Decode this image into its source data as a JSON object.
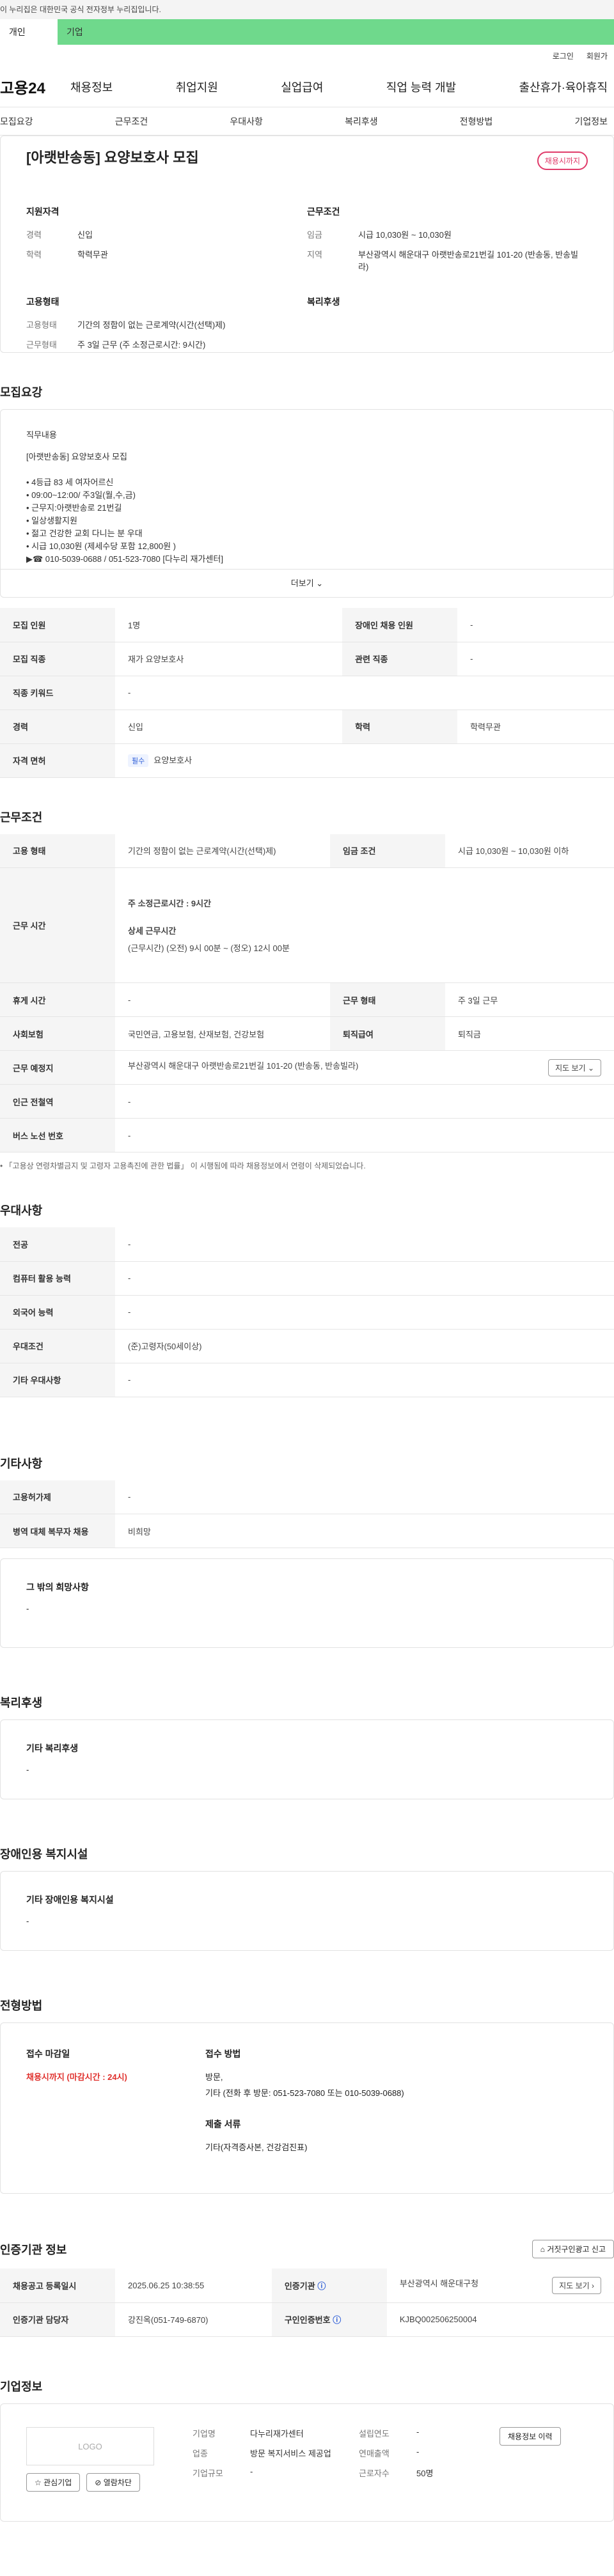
{
  "banner": {
    "text": "이 누리집은 대한민국 공식 전자정부 누리집입니다."
  },
  "top_tabs": {
    "individual": "개인",
    "company": "기업"
  },
  "util": {
    "login": "로그인",
    "signup": "회원가"
  },
  "gnb": {
    "logo": "고용24",
    "menu": [
      "채용정보",
      "취업지원",
      "실업급여",
      "직업 능력 개발",
      "출산휴가·육아휴직"
    ]
  },
  "subnav": [
    "모집요강",
    "근무조건",
    "우대사항",
    "복리후생",
    "전형방법",
    "기업정보"
  ],
  "summary": {
    "title": "[아랫반송동] 요양보호사 모집",
    "badge": "채용시까지",
    "support": {
      "heading": "지원자격",
      "career_k": "경력",
      "career_v": "신입",
      "edu_k": "학력",
      "edu_v": "학력무관"
    },
    "condition": {
      "heading": "근무조건",
      "wage_k": "임금",
      "wage_v": "시급 10,030원 ~ 10,030원",
      "loc_k": "지역",
      "loc_v": "부산광역시 해운대구 아랫반송로21번길 101-20 (반송동, 반송빌라)"
    },
    "employ": {
      "heading": "고용형태",
      "type_k": "고용형태",
      "type_v": "기간의 정함이 없는 근로계약(시간(선택)제)",
      "work_k": "근무형태",
      "work_v": "주 3일 근무 (주 소정근로시간: 9시간)"
    },
    "welfare": {
      "heading": "복리후생"
    }
  },
  "sections": {
    "recruit": "모집요강",
    "conditions": "근무조건",
    "prefer": "우대사항",
    "etc": "기타사항",
    "welfare": "복리후생",
    "disabled": "장애인용 복지시설",
    "process": "전형방법",
    "cert": "인증기관 정보",
    "company": "기업정보"
  },
  "job_desc": {
    "label": "직무내용",
    "title_line": "[아랫반송동] 요양보호사 모집",
    "lines": [
      "• 4등급 83 세 여자어르신",
      "• 09:00~12:00/ 주3일(월,수,금)",
      "• 근무지:아랫반송로 21번길",
      "• 일상생활지원",
      "• 젊고 건강한 교회 다니는 분 우대",
      "• 시급 10,030원 (제세수당 포함 12,800원 )",
      "▶☎ 010-5039-0688 / 051-523-7080 [다누리 재가센터]"
    ],
    "more": "더보기"
  },
  "recruit_table": [
    {
      "h1": "모집 인원",
      "v1": "1명",
      "h2": "장애인 채용 인원",
      "v2": "-"
    },
    {
      "h1": "모집 직종",
      "v1": "재가 요양보호사",
      "h2": "관련 직종",
      "v2": "-"
    },
    {
      "h1": "직종 키워드",
      "v1": "-"
    },
    {
      "h1": "경력",
      "v1": "신입",
      "h2": "학력",
      "v2": "학력무관"
    },
    {
      "h1": "자격 면허",
      "chip": "필수",
      "v1": "요양보호사"
    }
  ],
  "cond_table": {
    "type_h": "고용 형태",
    "type_v": "기간의 정함이 없는 근로계약(시간(선택)제)",
    "wage_h": "임금 조건",
    "wage_v": "시급 10,030원 ~ 10,030원 이하",
    "time_h": "근무 시간",
    "time_total": "주 소정근로시간 : 9시간",
    "time_detail_t": "상세 근무시간",
    "time_detail_v": "(근무시간) (오전) 9시 00분 ~ (정오) 12시 00분",
    "break_h": "휴게 시간",
    "break_v": "-",
    "form_h": "근무 형태",
    "form_v": "주 3일 근무",
    "ins_h": "사회보험",
    "ins_v": "국민연금, 고용보험, 산재보험, 건강보험",
    "ret_h": "퇴직급여",
    "ret_v": "퇴직금",
    "place_h": "근무 예정지",
    "place_v": "부산광역시 해운대구 아랫반송로21번길 101-20 (반송동, 반송빌라)",
    "map_btn": "지도 보기",
    "station_h": "인근 전철역",
    "station_v": "-",
    "bus_h": "버스 노선 번호",
    "bus_v": "-",
    "note": "• 「고용상 연령차별금지 및 고령자 고용촉진에 관한 법률」 이 시행됨에 따라 채용정보에서 연령이 삭제되었습니다."
  },
  "prefer_table": [
    {
      "h": "전공",
      "v": "-"
    },
    {
      "h": "컴퓨터 활용 능력",
      "v": "-"
    },
    {
      "h": "외국어 능력",
      "v": "-"
    },
    {
      "h": "우대조건",
      "v": "(준)고령자(50세이상)"
    },
    {
      "h": "기타 우대사항",
      "v": "-"
    }
  ],
  "etc_table": [
    {
      "h": "고용허가제",
      "v": "-"
    },
    {
      "h": "병역 대체 복무자 채용",
      "v": "비희망"
    }
  ],
  "etc_box": {
    "t": "그 밖의 희망사항",
    "v": "-"
  },
  "welfare_box": {
    "t": "기타 복리후생",
    "v": "-"
  },
  "disabled_box": {
    "t": "기타 장애인용 복지시설",
    "v": "-"
  },
  "process": {
    "deadline_t": "접수 마감일",
    "deadline_v": "채용시까지 (마감시간 : 24시)",
    "method_t": "접수 방법",
    "method_v1": "방문,",
    "method_v2": "기타 (전화 후 방문: 051-523-7080 또는 010-5039-0688)",
    "docs_t": "제출 서류",
    "docs_v": "기타(자격증사본, 건강검진표)"
  },
  "cert": {
    "report_btn": "거짓구인광고 신고",
    "reg_h": "채용공고 등록일시",
    "reg_v": "2025.06.25 10:38:55",
    "org_h": "인증기관",
    "org_v": "부산광역시 해운대구청",
    "map_btn": "지도 보기",
    "mgr_h": "인증기관 담당자",
    "mgr_v": "강진옥(051-749-6870)",
    "no_h": "구인인증번호",
    "no_v": "KJBQ002506250004"
  },
  "company": {
    "logo": "LOGO",
    "fav_btn": "관심기업",
    "block_btn": "열람차단",
    "name_k": "기업명",
    "name_v": "다누리재가센터",
    "ind_k": "업종",
    "ind_v": "방문 복지서비스 제공업",
    "size_k": "기업규모",
    "size_v": "-",
    "year_k": "설립연도",
    "year_v": "-",
    "sales_k": "연매출액",
    "sales_v": "-",
    "emp_k": "근로자수",
    "emp_v": "50명",
    "history_btn": "채용정보 이력"
  }
}
